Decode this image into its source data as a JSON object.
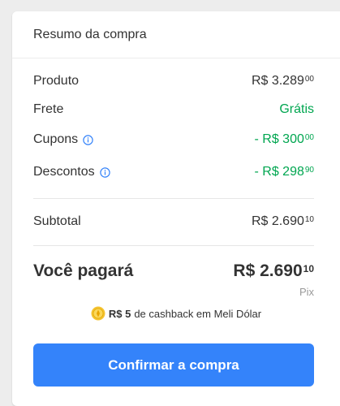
{
  "summary": {
    "title": "Resumo da compra",
    "rows": [
      {
        "label": "Produto",
        "price_main": "R$ 3.289",
        "price_cents": "00",
        "info": false,
        "color": "#333333"
      },
      {
        "label": "Frete",
        "price_main": "Grátis",
        "price_cents": "",
        "info": false,
        "color": "#00a650"
      },
      {
        "label": "Cupons",
        "price_main": "- R$ 300",
        "price_cents": "00",
        "info": true,
        "color": "#00a650"
      },
      {
        "label": "Descontos",
        "price_main": "- R$ 298",
        "price_cents": "90",
        "info": true,
        "color": "#00a650"
      }
    ],
    "subtotal": {
      "label": "Subtotal",
      "price_main": "R$ 2.690",
      "price_cents": "10"
    },
    "total": {
      "label": "Você pagará",
      "price_main": "R$ 2.690",
      "price_cents": "10",
      "method": "Pix"
    },
    "cashback": {
      "amount": "R$ 5",
      "text": "de cashback em Meli Dólar",
      "icon": "coin-icon"
    },
    "confirm_button": "Confirmar a compra"
  },
  "colors": {
    "accent": "#3483fa",
    "success": "#00a650",
    "info": "#3483fa"
  }
}
